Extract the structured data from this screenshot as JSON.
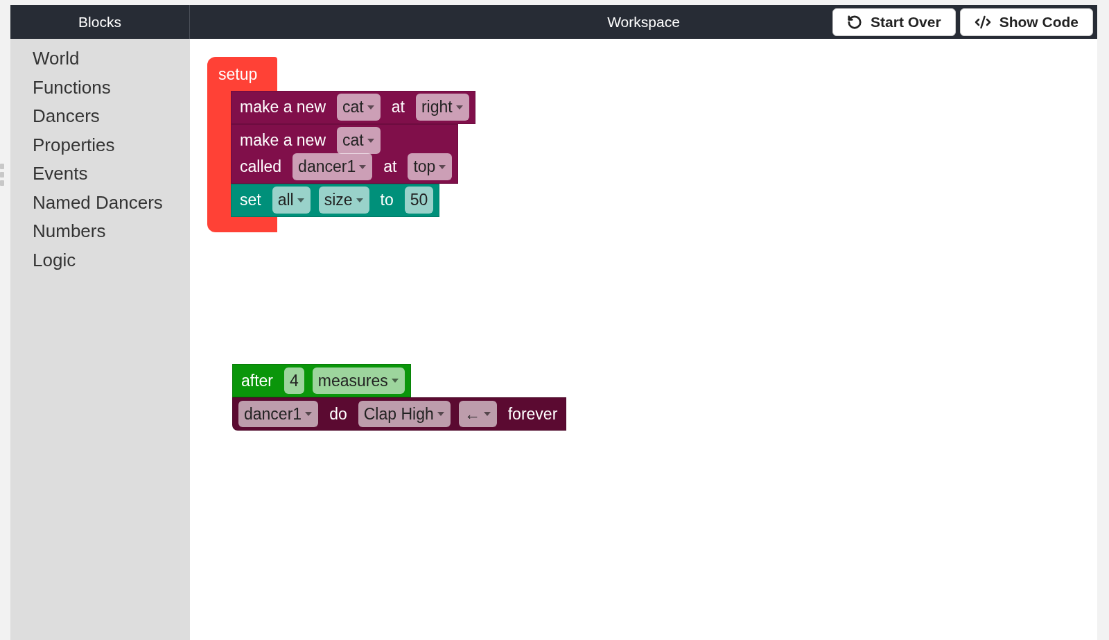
{
  "header": {
    "sidebar_title": "Blocks",
    "workspace_title": "Workspace",
    "buttons": [
      {
        "kind": "restart",
        "label": "Start Over"
      },
      {
        "kind": "code",
        "label": "Show Code"
      }
    ]
  },
  "sidebar": {
    "items": [
      {
        "label": "World"
      },
      {
        "label": "Functions"
      },
      {
        "label": "Dancers"
      },
      {
        "label": "Properties"
      },
      {
        "label": "Events"
      },
      {
        "label": "Named Dancers"
      },
      {
        "label": "Numbers"
      },
      {
        "label": "Logic"
      }
    ]
  },
  "workspace": {
    "stacks": [
      {
        "kind": "event",
        "label": "setup",
        "color": "#ff4136",
        "blocks": [
          {
            "color": "#800f4a",
            "rows": [
              [
                {
                  "kind": "text",
                  "text": "make a new"
                },
                {
                  "kind": "dropdown",
                  "text": "cat"
                },
                {
                  "kind": "text",
                  "text": "at"
                },
                {
                  "kind": "dropdown",
                  "text": "right"
                }
              ]
            ]
          },
          {
            "color": "#800f4a",
            "rows": [
              [
                {
                  "kind": "text",
                  "text": "make a new"
                },
                {
                  "kind": "dropdown",
                  "text": "cat"
                }
              ],
              [
                {
                  "kind": "text",
                  "text": "called"
                },
                {
                  "kind": "dropdown",
                  "text": "dancer1"
                },
                {
                  "kind": "text",
                  "text": "at"
                },
                {
                  "kind": "dropdown",
                  "text": "top"
                }
              ]
            ]
          },
          {
            "color": "#00907a",
            "rows": [
              [
                {
                  "kind": "text",
                  "text": "set"
                },
                {
                  "kind": "dropdown",
                  "text": "all"
                },
                {
                  "kind": "dropdown",
                  "text": "size"
                },
                {
                  "kind": "text",
                  "text": "to"
                },
                {
                  "kind": "number",
                  "text": "50"
                }
              ]
            ]
          }
        ]
      },
      {
        "kind": "plain",
        "blocks": [
          {
            "color": "#0a960a",
            "rows": [
              [
                {
                  "kind": "text",
                  "text": "after"
                },
                {
                  "kind": "number",
                  "text": "4"
                },
                {
                  "kind": "dropdown",
                  "text": "measures"
                }
              ]
            ]
          },
          {
            "color": "#5b0a31",
            "rows": [
              [
                {
                  "kind": "dropdown",
                  "text": "dancer1"
                },
                {
                  "kind": "text",
                  "text": "do"
                },
                {
                  "kind": "dropdown",
                  "text": "Clap High"
                },
                {
                  "kind": "dropdown",
                  "text": "←"
                },
                {
                  "kind": "text",
                  "text": "forever"
                }
              ]
            ]
          }
        ]
      }
    ]
  }
}
